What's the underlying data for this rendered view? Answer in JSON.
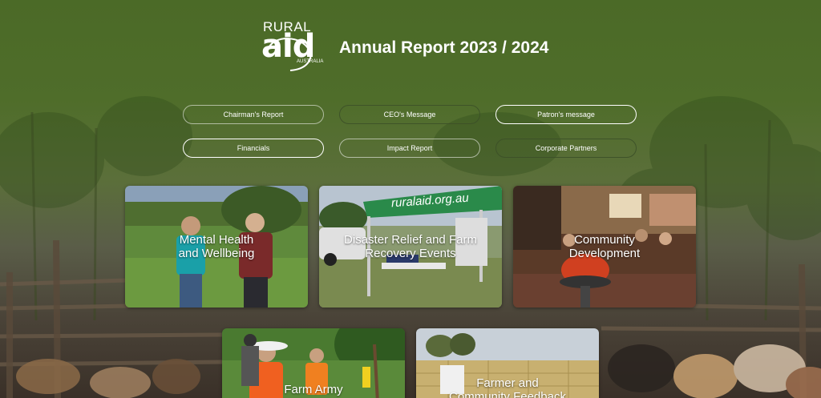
{
  "header": {
    "logo": {
      "top_text": "RURAL",
      "main_text": "aid",
      "sub_text": "AUSTRALIA"
    },
    "title": "Annual Report 2023 / 2024"
  },
  "nav": {
    "row1": [
      {
        "label": "Chairman's Report"
      },
      {
        "label": "CEO's Message"
      },
      {
        "label": "Patron's message"
      }
    ],
    "row2": [
      {
        "label": "Financials"
      },
      {
        "label": "Impact Report"
      },
      {
        "label": "Corporate Partners"
      }
    ]
  },
  "cards": [
    {
      "label_line1": "Mental Health",
      "label_line2": "and Wellbeing"
    },
    {
      "label_line1": "Disaster Relief and Farm",
      "label_line2": "Recovery Events",
      "banner_text": "ruralaid.org.au"
    },
    {
      "label_line1": "Community",
      "label_line2": "Development"
    },
    {
      "label_line1": "Farm Army",
      "label_line2": ""
    },
    {
      "label_line1": "Farmer and",
      "label_line2": "Community Feedback"
    }
  ],
  "colors": {
    "background_green": "#4b6a27",
    "text": "#ffffff"
  }
}
